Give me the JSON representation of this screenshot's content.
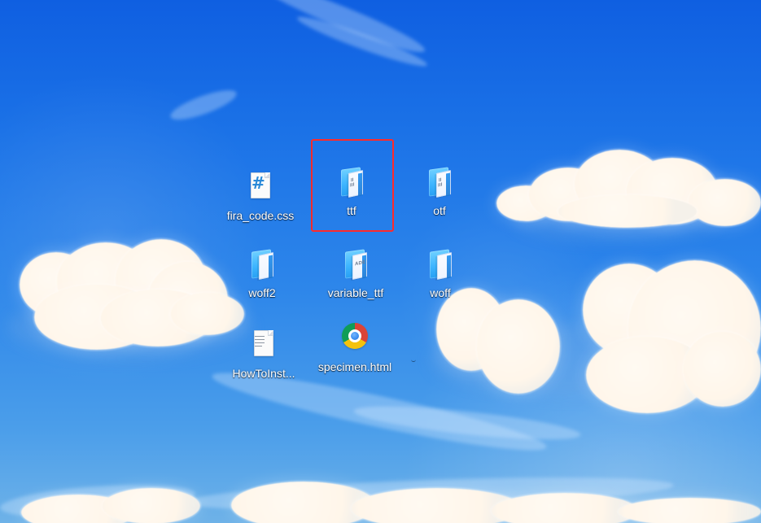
{
  "desktop": {
    "icons": [
      {
        "label": "fira_code.css",
        "icon": "css-file-icon"
      },
      {
        "label": "ttf",
        "icon": "folder-icon"
      },
      {
        "label": "otf",
        "icon": "folder-icon"
      },
      {
        "label": "woff2",
        "icon": "folder-icon"
      },
      {
        "label": "variable_ttf",
        "icon": "folder-icon"
      },
      {
        "label": "woff",
        "icon": "folder-icon"
      },
      {
        "label": "HowToInst...",
        "icon": "text-file-icon"
      },
      {
        "label": "specimen.html",
        "icon": "chrome-icon"
      }
    ]
  },
  "colors": {
    "selection": "#ff2a2a",
    "label_text": "#ffffff"
  }
}
